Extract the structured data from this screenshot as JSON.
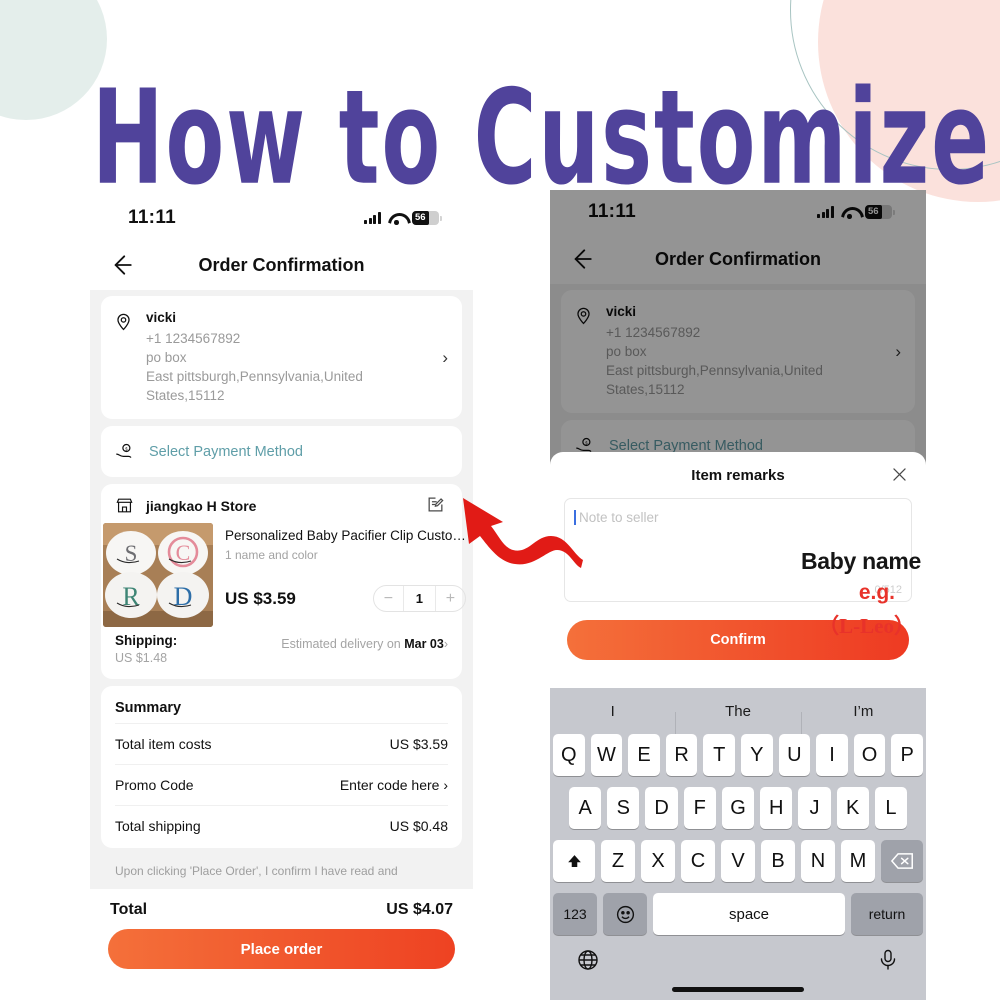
{
  "poster": {
    "headline": "How to Customize",
    "headline_color": "#50439b",
    "deco": {
      "mint_color": "#e4eeeb",
      "pink_color": "#fbe1dc",
      "ring_color": "#a8c4c2"
    },
    "arrow_color": "#e11b16"
  },
  "status_bar": {
    "time": "11:11",
    "battery_level": "56",
    "signal_icon": "signal-bars-icon",
    "wifi_icon": "wifi-icon",
    "battery_icon": "battery-icon"
  },
  "nav": {
    "back_icon": "back-arrow-icon",
    "title": "Order Confirmation"
  },
  "address": {
    "pin_icon": "location-pin-icon",
    "name": "vicki",
    "phone": "+1 1234567892",
    "line1": "po box",
    "line2": "East pittsburgh,Pennsylvania,United",
    "line3": "States,15112",
    "chevron": "›"
  },
  "payment": {
    "icon": "payment-hand-money-icon",
    "label": "Select Payment Method",
    "label_color": "#5f9ea8"
  },
  "store": {
    "icon": "storefront-icon",
    "name": "jiangkao H Store",
    "edit_icon": "edit-note-icon"
  },
  "product": {
    "title": "Personalized Baby Pacifier Clip Custo…",
    "variant": "1 name and color",
    "price": "US $3.59",
    "qty": "1",
    "minus": "−",
    "plus": "+",
    "image_alt": "four-monogram-baby-bibs",
    "monograms": [
      "S",
      "C",
      "R",
      "D"
    ]
  },
  "shipping": {
    "label": "Shipping:",
    "cost": "US $1.48",
    "estimate_prefix": "Estimated delivery on ",
    "estimate_date": "Mar 03",
    "chevron": "›"
  },
  "summary": {
    "heading": "Summary",
    "rows": [
      {
        "label": "Total item costs",
        "value": "US $3.59"
      },
      {
        "label": "Promo Code",
        "value": "Enter code here ›"
      },
      {
        "label": "Total shipping",
        "value": "US $0.48"
      }
    ]
  },
  "disclaimer": "Upon clicking 'Place Order', I confirm I have read and",
  "footer": {
    "total_label": "Total",
    "total_value": "US $4.07",
    "cta_label": "Place order",
    "cta_color_from": "#f4703a",
    "cta_color_to": "#ee4222"
  },
  "sheet": {
    "title": "Item remarks",
    "close_icon": "close-x-icon",
    "textarea_placeholder": "Note to seller",
    "textarea_value": "",
    "counter": "0/512",
    "confirm_label": "Confirm"
  },
  "annotation": {
    "line1": "Baby name",
    "line2": "e.g.",
    "line3": "（L-Leo）",
    "line1_color": "#161616",
    "accent_color": "#e8322a"
  },
  "keyboard": {
    "predictions": [
      "I",
      "The",
      "I’m"
    ],
    "row1": [
      "Q",
      "W",
      "E",
      "R",
      "T",
      "Y",
      "U",
      "I",
      "O",
      "P"
    ],
    "row2": [
      "A",
      "S",
      "D",
      "F",
      "G",
      "H",
      "J",
      "K",
      "L"
    ],
    "row3": [
      "Z",
      "X",
      "C",
      "V",
      "B",
      "N",
      "M"
    ],
    "shift_icon": "shift-up-arrow-icon",
    "backspace_icon": "backspace-delete-icon",
    "numbers_key": "123",
    "emoji_icon": "emoji-smiley-icon",
    "space_key": "space",
    "return_key": "return",
    "globe_icon": "globe-language-icon",
    "mic_icon": "microphone-icon"
  }
}
